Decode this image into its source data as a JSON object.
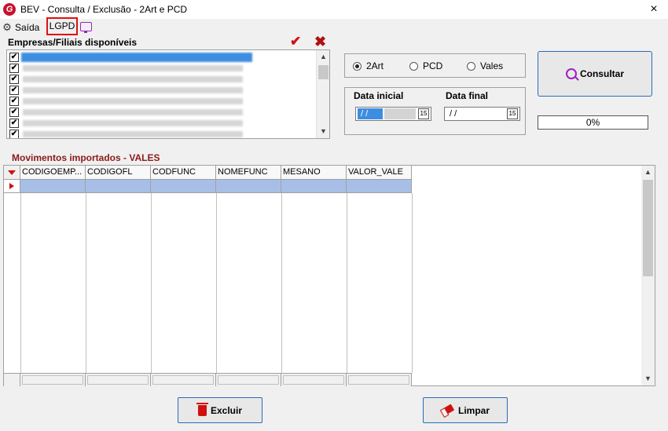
{
  "window": {
    "title": "BEV - Consulta / Exclusão - 2Art e PCD",
    "close_icon": "×"
  },
  "menu": {
    "saida": "Saída",
    "lgpd": "LGPD"
  },
  "empresas": {
    "label": "Empresas/Filiais disponíveis",
    "check_all_icon": "✔",
    "uncheck_all_icon": "✖",
    "checkbox_mark": "✔"
  },
  "tipo": {
    "options": [
      "2Art",
      "PCD",
      "Vales"
    ],
    "selected": "2Art"
  },
  "datas": {
    "inicial_label": "Data inicial",
    "final_label": "Data final",
    "inicial_value": " / /",
    "final_value": " / /",
    "calendar_icon": "15"
  },
  "buttons": {
    "consultar": "Consultar",
    "excluir": "Excluir",
    "limpar": "Limpar"
  },
  "progress": {
    "text": "0%",
    "value": 0
  },
  "movimentos": {
    "label": "Movimentos importados  - VALES",
    "columns": [
      "CODIGOEMP...",
      "CODIGOFL",
      "CODFUNC",
      "NOMEFUNC",
      "MESANO",
      "VALOR_VALE"
    ]
  },
  "scroll": {
    "up": "▲",
    "down": "▼"
  },
  "colors": {
    "accent_red": "#d01010",
    "selection_blue": "#3d8de0",
    "row_highlight": "#a7bfe6",
    "section_label": "#8b1a1a"
  }
}
